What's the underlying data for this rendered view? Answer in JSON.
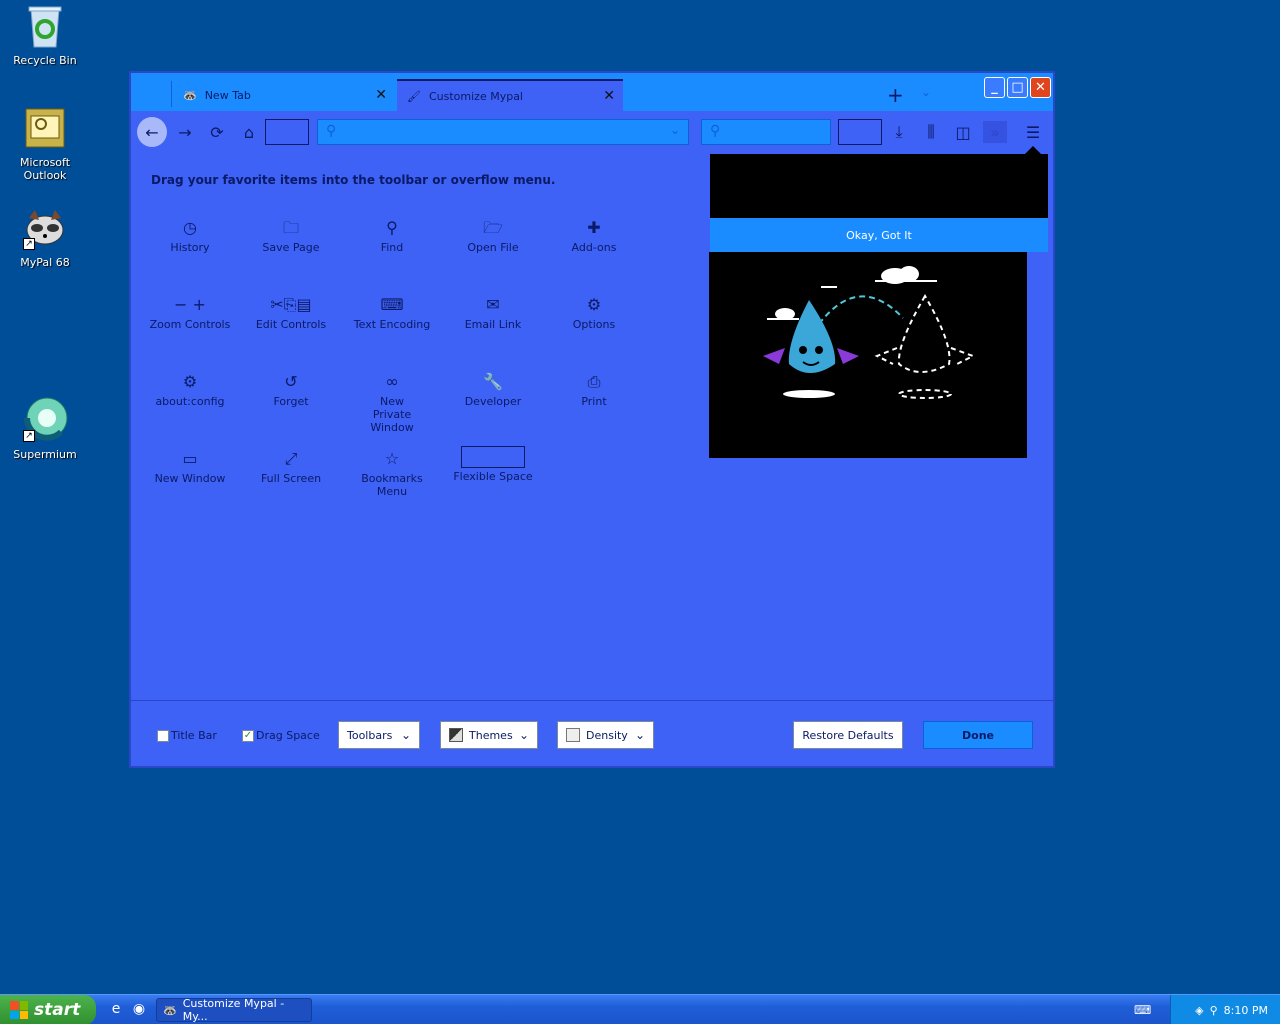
{
  "desktop": {
    "icons": [
      {
        "label": "Recycle Bin"
      },
      {
        "label": "Microsoft Outlook"
      },
      {
        "label": "MyPal 68"
      },
      {
        "label": "Supermium"
      }
    ]
  },
  "browser": {
    "tabs": [
      {
        "label": "New Tab"
      },
      {
        "label": "Customize Mypal"
      }
    ],
    "heading": "Drag your favorite items into the toolbar or overflow menu.",
    "palette": [
      {
        "label": "History",
        "icon": "clock-icon"
      },
      {
        "label": "Save Page",
        "icon": "save-page-icon"
      },
      {
        "label": "Find",
        "icon": "search-icon"
      },
      {
        "label": "Open File",
        "icon": "open-file-icon"
      },
      {
        "label": "Add-ons",
        "icon": "puzzle-icon"
      },
      {
        "label": "Zoom Controls",
        "icon": "zoom-icon"
      },
      {
        "label": "Edit Controls",
        "icon": "edit-icon"
      },
      {
        "label": "Text Encoding",
        "icon": "encoding-icon"
      },
      {
        "label": "Email Link",
        "icon": "email-icon"
      },
      {
        "label": "Options",
        "icon": "gear-icon"
      },
      {
        "label": "about:config",
        "icon": "gear-icon"
      },
      {
        "label": "Forget",
        "icon": "forget-icon"
      },
      {
        "label": "New Private Window",
        "icon": "mask-icon"
      },
      {
        "label": "Developer",
        "icon": "wrench-icon"
      },
      {
        "label": "Print",
        "icon": "printer-icon"
      },
      {
        "label": "New Window",
        "icon": "new-window-icon"
      },
      {
        "label": "Full Screen",
        "icon": "fullscreen-icon"
      },
      {
        "label": "Bookmarks Menu",
        "icon": "bookmarks-icon"
      },
      {
        "label": "Flexible Space",
        "icon": "flexible-space"
      }
    ],
    "footer": {
      "title_bar": "Title Bar",
      "drag_space": "Drag Space",
      "toolbars": "Toolbars",
      "themes": "Themes",
      "density": "Density",
      "restore": "Restore Defaults",
      "done": "Done"
    },
    "popup": {
      "ok_button": "Okay, Got It"
    }
  },
  "taskbar": {
    "start": "start",
    "task_label": "Customize Mypal - My...",
    "clock": "8:10 PM"
  },
  "colors": {
    "desktop": "#004e98",
    "window_bg": "#3d62f5",
    "accent": "#1a8cff",
    "text": "#0b1a66"
  }
}
